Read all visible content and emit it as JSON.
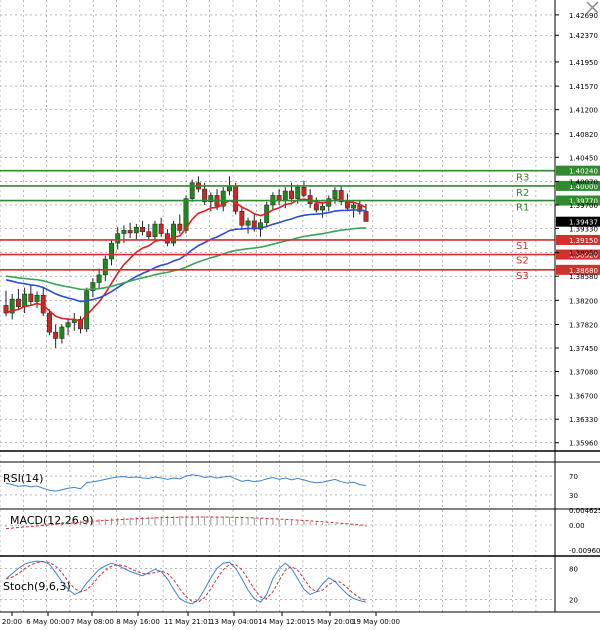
{
  "colors": {
    "bull": "#1b8a1b",
    "bear": "#c62828",
    "resistance": "#2e8b2e",
    "support": "#d32f2f",
    "ma_fast": "#e02020",
    "ma_mid": "#2a4fd0",
    "ma_slow": "#3aa55a",
    "grid": "#8a8a8a",
    "rsi": "#3b82d8",
    "macd_hist": "#9a9a9a",
    "macd_signal": "#d32f2f",
    "stoch_k": "#3b82d8",
    "stoch_d": "#d32f2f"
  },
  "icons": {
    "corner": "close-icon"
  },
  "chart_data": {
    "type": "candlestick",
    "instrument_price_axis": {
      "ticks": [
        "1.42690",
        "1.42370",
        "1.41950",
        "1.41570",
        "1.41200",
        "1.40820",
        "1.40450",
        "1.40070",
        "1.39700",
        "1.39330",
        "1.38950",
        "1.38580",
        "1.38200",
        "1.37820",
        "1.37450",
        "1.37080",
        "1.36700",
        "1.36330",
        "1.35960"
      ],
      "range": [
        1.3583,
        1.4283
      ],
      "current_price": "1.39437"
    },
    "levels": [
      {
        "name": "R3",
        "value": 1.4024,
        "label": "1.40240",
        "kind": "resistance"
      },
      {
        "name": "R2",
        "value": 1.4,
        "label": "1.40000",
        "kind": "resistance"
      },
      {
        "name": "R1",
        "value": 1.3977,
        "label": "1.39770",
        "kind": "resistance"
      },
      {
        "name": "S1",
        "value": 1.3915,
        "label": "1.39150",
        "kind": "support"
      },
      {
        "name": "S2",
        "value": 1.3892,
        "label": "1.38920",
        "kind": "support"
      },
      {
        "name": "S3",
        "value": 1.3868,
        "label": "1.38680",
        "kind": "support"
      }
    ],
    "x_labels": [
      "20:00",
      "6 May 00:00",
      "7 May 08:00",
      "8 May 16:00",
      "11 May 21:01",
      "13 May 04:00",
      "14 May 12:00",
      "15 May 20:00",
      "19 May 00:00"
    ],
    "candles": [
      [
        1.3812,
        1.3835,
        1.3795,
        1.38
      ],
      [
        1.38,
        1.383,
        1.379,
        1.3822
      ],
      [
        1.3822,
        1.3838,
        1.3805,
        1.381
      ],
      [
        1.381,
        1.384,
        1.38,
        1.383
      ],
      [
        1.383,
        1.3845,
        1.3812,
        1.3818
      ],
      [
        1.3818,
        1.3834,
        1.3808,
        1.3828
      ],
      [
        1.3828,
        1.384,
        1.3795,
        1.38
      ],
      [
        1.38,
        1.3806,
        1.3765,
        1.377
      ],
      [
        1.377,
        1.3782,
        1.3745,
        1.376
      ],
      [
        1.376,
        1.3782,
        1.3752,
        1.3778
      ],
      [
        1.3778,
        1.3792,
        1.3765,
        1.3785
      ],
      [
        1.3785,
        1.38,
        1.3772,
        1.379
      ],
      [
        1.379,
        1.3795,
        1.3768,
        1.3775
      ],
      [
        1.3775,
        1.384,
        1.377,
        1.3835
      ],
      [
        1.3835,
        1.3855,
        1.3825,
        1.3848
      ],
      [
        1.3848,
        1.387,
        1.3838,
        1.386
      ],
      [
        1.386,
        1.389,
        1.385,
        1.3885
      ],
      [
        1.3885,
        1.3915,
        1.3875,
        1.391
      ],
      [
        1.391,
        1.3935,
        1.39,
        1.3925
      ],
      [
        1.3925,
        1.3938,
        1.391,
        1.393
      ],
      [
        1.393,
        1.3942,
        1.3918,
        1.3926
      ],
      [
        1.3926,
        1.394,
        1.3915,
        1.3935
      ],
      [
        1.3935,
        1.3945,
        1.3922,
        1.3928
      ],
      [
        1.3928,
        1.394,
        1.3914,
        1.392
      ],
      [
        1.392,
        1.3945,
        1.3915,
        1.394
      ],
      [
        1.394,
        1.395,
        1.392,
        1.3925
      ],
      [
        1.3925,
        1.3932,
        1.3905,
        1.391
      ],
      [
        1.391,
        1.3945,
        1.3905,
        1.394
      ],
      [
        1.394,
        1.3955,
        1.3925,
        1.393
      ],
      [
        1.393,
        1.3985,
        1.3925,
        1.398
      ],
      [
        1.398,
        1.401,
        1.3975,
        1.4005
      ],
      [
        1.4005,
        1.4015,
        1.399,
        1.3995
      ],
      [
        1.3995,
        1.4005,
        1.397,
        1.3975
      ],
      [
        1.3975,
        1.399,
        1.396,
        1.3985
      ],
      [
        1.3985,
        1.3995,
        1.3962,
        1.3968
      ],
      [
        1.3968,
        1.3998,
        1.396,
        1.3992
      ],
      [
        1.3992,
        1.4015,
        1.3985,
        1.4
      ],
      [
        1.4,
        1.4005,
        1.3955,
        1.396
      ],
      [
        1.396,
        1.3968,
        1.3932,
        1.3938
      ],
      [
        1.3938,
        1.395,
        1.3925,
        1.3945
      ],
      [
        1.3945,
        1.3955,
        1.3928,
        1.3932
      ],
      [
        1.3932,
        1.3948,
        1.392,
        1.3942
      ],
      [
        1.3942,
        1.3975,
        1.3935,
        1.397
      ],
      [
        1.397,
        1.399,
        1.3962,
        1.3985
      ],
      [
        1.3985,
        1.3995,
        1.397,
        1.3978
      ],
      [
        1.3978,
        1.3998,
        1.3965,
        1.3992
      ],
      [
        1.3992,
        1.4005,
        1.3975,
        1.398
      ],
      [
        1.398,
        1.4002,
        1.3972,
        1.3998
      ],
      [
        1.3998,
        1.4008,
        1.3982,
        1.3985
      ],
      [
        1.3985,
        1.3995,
        1.3965,
        1.3972
      ],
      [
        1.3972,
        1.3982,
        1.3958,
        1.3962
      ],
      [
        1.3962,
        1.3975,
        1.395,
        1.3968
      ],
      [
        1.3968,
        1.3985,
        1.396,
        1.398
      ],
      [
        1.398,
        1.3998,
        1.3972,
        1.3993
      ],
      [
        1.3993,
        1.4,
        1.397,
        1.3975
      ],
      [
        1.3975,
        1.3988,
        1.396,
        1.3965
      ],
      [
        1.3965,
        1.3975,
        1.395,
        1.397
      ],
      [
        1.397,
        1.3978,
        1.3955,
        1.396
      ],
      [
        1.396,
        1.3972,
        1.3944,
        1.3944
      ]
    ],
    "indicators": {
      "rsi": {
        "label": "RSI(14)",
        "levels": [
          "70",
          "30"
        ],
        "values": [
          55,
          52,
          48,
          50,
          47,
          49,
          44,
          40,
          38,
          41,
          44,
          46,
          43,
          56,
          58,
          60,
          63,
          66,
          68,
          69,
          67,
          68,
          66,
          65,
          68,
          66,
          63,
          66,
          64,
          70,
          73,
          71,
          67,
          69,
          66,
          68,
          70,
          64,
          59,
          61,
          58,
          60,
          64,
          67,
          63,
          66,
          62,
          65,
          62,
          58,
          56,
          57,
          60,
          63,
          58,
          55,
          57,
          52,
          50
        ]
      },
      "macd": {
        "label": "MACD(12,26,9)",
        "levels": [
          "0.004625",
          "0.00",
          "-0.009608"
        ]
      },
      "stoch": {
        "label": "Stoch(9,6,3)",
        "levels": [
          "80",
          "20"
        ]
      }
    }
  }
}
